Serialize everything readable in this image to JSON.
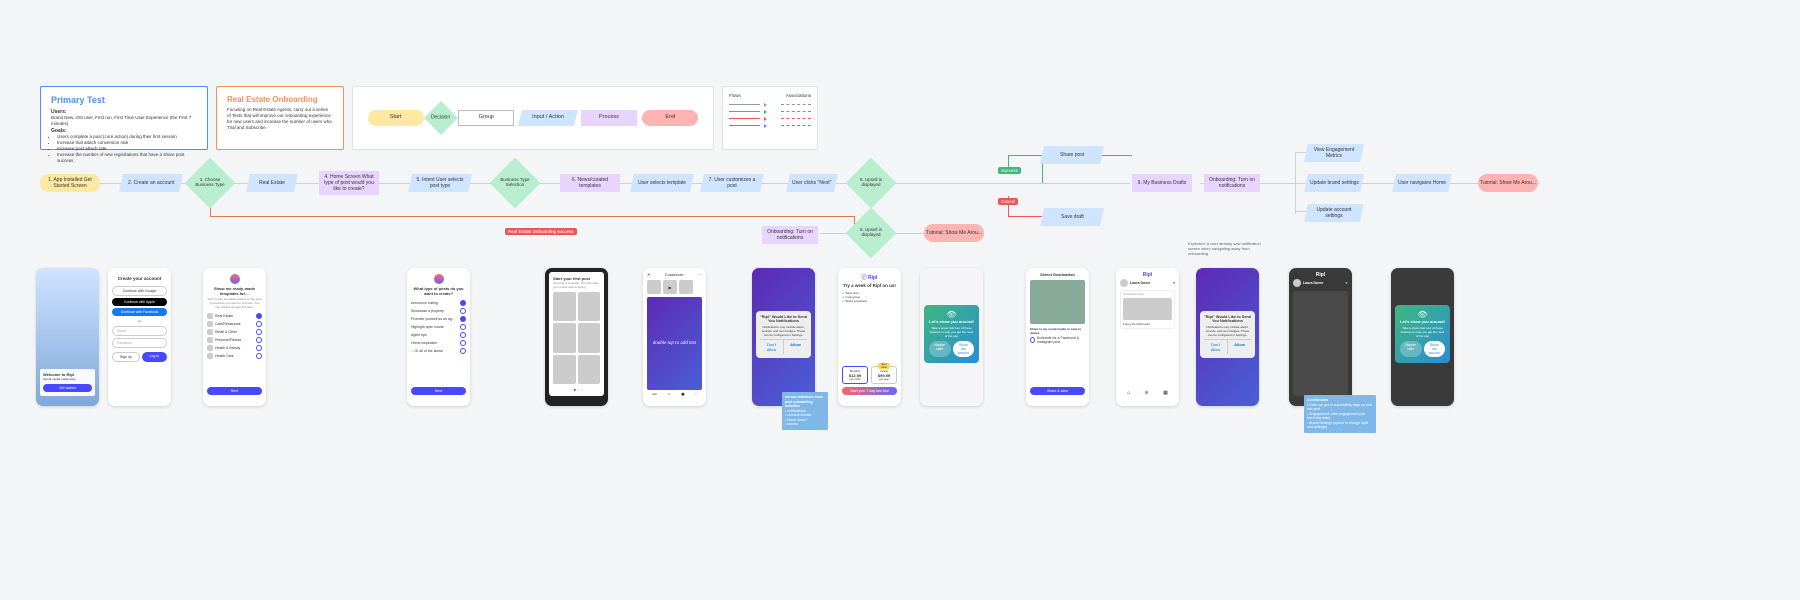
{
  "primary": {
    "title": "Primary Test",
    "users_label": "Users:",
    "users_text": "Brand New, iOS user, First run, First Time User Experience (the First 7 minutes)",
    "goals_label": "Goals:",
    "goals": [
      "Users complete a post (core action) during their first session",
      "Increase trial attach conversion rate",
      "Increase post attach rate",
      "Increase the number of new registrations that have a share post success"
    ]
  },
  "onboard": {
    "title": "Real Estate Onboarding",
    "text": "Focusing on Real Estate Agents, carry out a series of Tests that will improve our onboarding experience for new users and increase the number of users who Trial and Subscribe."
  },
  "legend": {
    "start": "Start",
    "decision": "Decision",
    "group": "Group",
    "input": "Input / Action",
    "process": "Process",
    "end": "End"
  },
  "flows": {
    "head_flows": "Flows",
    "head_assoc": "Associations"
  },
  "nodes": {
    "n1": "1. App Installed\nGet Started Screen",
    "n2": "2. Create an account",
    "n3": "3. Choose Business Type",
    "n3b": "Real Estate",
    "n4": "4. Home Screen\nWhat type of post would you like to create?",
    "n5": "5. Intent\nUser selects post type",
    "n6": "Business Type Selection",
    "n7": "6. News/curated templates",
    "n8": "User selects template",
    "n9": "7. User customizes a post",
    "n10": "User clicks \"Next\"",
    "n11": "8. Upsell is displayed",
    "n12": "Share post",
    "n13": "Save draft",
    "n14": "9. My Business Drafts",
    "n15": "Onboarding: Turn on notifications",
    "n16": "View Engagement Metrics",
    "n17": "Update brand settings",
    "n18": "Update account settings",
    "n19": "User navigates Home",
    "n20": "Tutorial: Show Me Arou...",
    "n21": "8. Upsell is displayed",
    "n22": "Onboarding: Turn on notifications",
    "n23": "Tutorial: Show Me Arou..."
  },
  "tags": {
    "success": "Success",
    "cancel": "Cancel",
    "badge": "Real Estate Onboarding success"
  },
  "cap1": "Expected: A user already saw notification screen when navigating away from onboarding",
  "sc": {
    "welcome_title": "Welcome to Ripl",
    "welcome_sub": "Social media made easy",
    "create_title": "Create your account",
    "g": "Continue with Google",
    "a": "Continue with Apple",
    "f": "Continue with Facebook",
    "or": "or",
    "email": "Email",
    "pass": "Password",
    "signup": "Sign up",
    "login": "Log in",
    "biz_title": "Show me ready-made templates for…",
    "biz_sub": "We'll curate templates based on the type of business you want to promote. You can always change this later.",
    "biz_items": [
      "Real Estate",
      "Cafe/Restaurant",
      "Retail & Other",
      "Personal/Fitness",
      "Health & Beauty",
      "Health Care",
      "Next"
    ],
    "intent_title": "What type of posts do you want to create?",
    "intent_items": [
      "Announce Listing",
      "Showcase a property",
      "Promote yourself as an ag…",
      "Highlight open house",
      "Agent tips",
      "Home inspiration",
      "…Or all of the above"
    ],
    "start_post": "Start your first post",
    "start_sub": "Opening a template, this will make your brand look amazing",
    "cust": "Customize",
    "dbl": "double tap to add text",
    "notif_title": "\"Ripl\" Would Like to Send You Notifications",
    "notif_body": "Notifications may include alerts, sounds, and icon badges. These can be configured in Settings.",
    "dont": "Don't Allow",
    "allow": "Allow",
    "try_title": "Try a week of Ripl on us!",
    "monthly": "Monthly",
    "yearly": "Yearly",
    "mp": "$12.99",
    "yp": "$99.99",
    "per_m": "per month",
    "per_y": "per year",
    "start_trial": "Start your 7-day free trial",
    "tour_title": "Let's show you around!",
    "tour_body": "Take a super-fast tour of these features to help you get the most of the app",
    "maybe": "Maybe later",
    "show": "Show me around",
    "share": "Select Destination",
    "share_sub": "Share to my social media or save to device",
    "share_btn": "Share & save",
    "share_opt": "Schedule for a Facebook & Instagram post",
    "home_brand": "Ripl",
    "user": "Laura Dover",
    "tip": "Funny Pet Moments",
    "note1": {
      "t": "we can introduce more post onboarding activities",
      "items": [
        "notifications",
        "connect socials",
        "brand deets?",
        "tutorial"
      ]
    },
    "note2": {
      "t": "Contribution",
      "items": [
        "Data: we get to successfully sign up and see post",
        "Engagement: view engagement (we need this data)",
        "Brand Settings (option to change style and settings)"
      ]
    }
  }
}
